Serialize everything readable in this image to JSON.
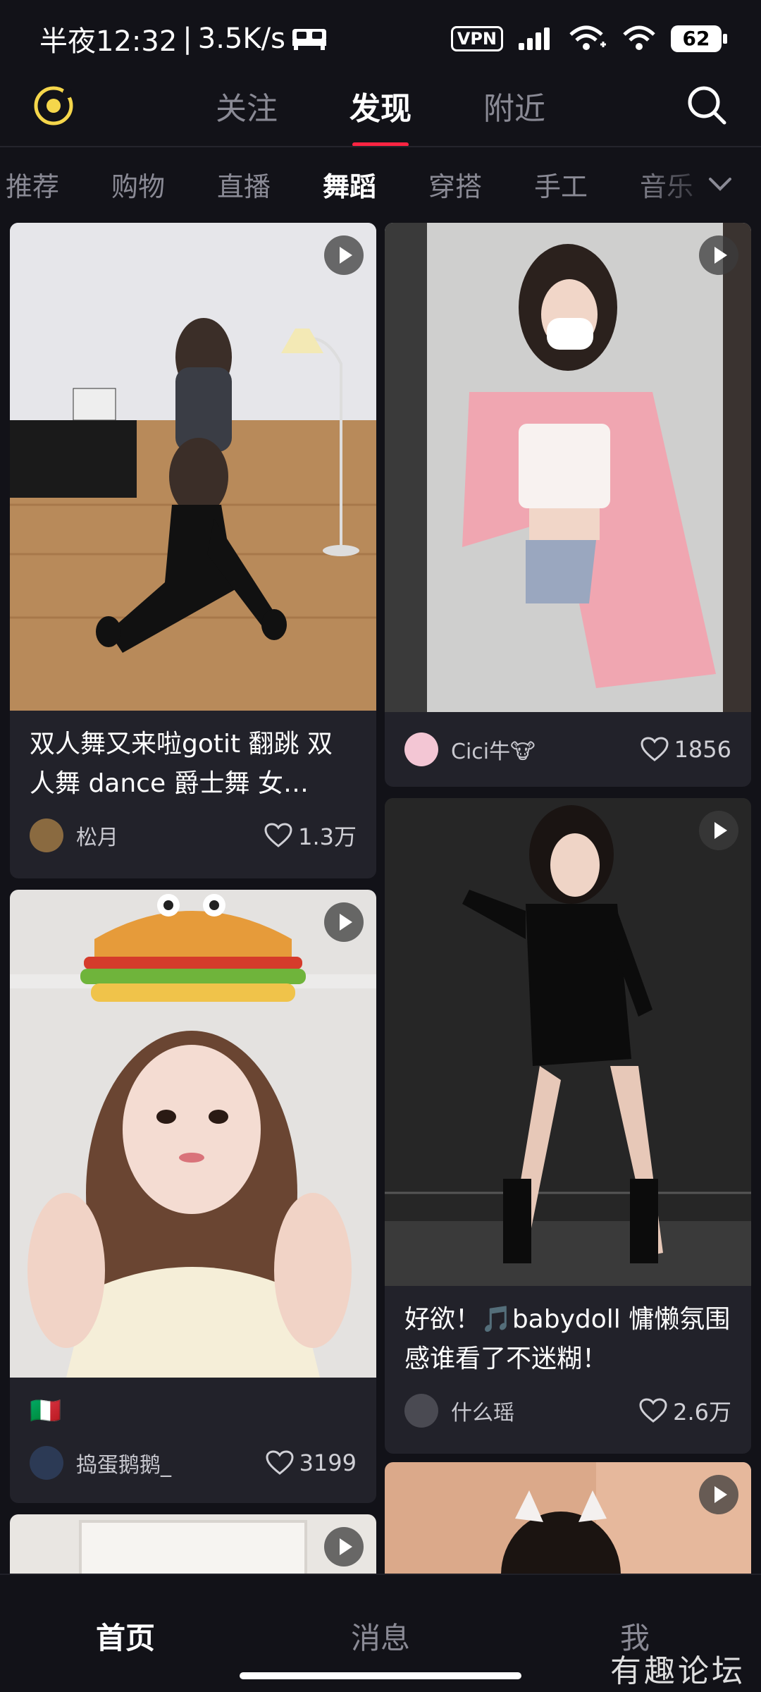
{
  "status_bar": {
    "time": "半夜12:32",
    "speed": "3.5K/s",
    "vpn": "VPN",
    "battery": "62"
  },
  "top_nav": {
    "tabs": [
      {
        "label": "关注"
      },
      {
        "label": "发现",
        "active": true
      },
      {
        "label": "附近"
      }
    ]
  },
  "categories": [
    "推荐",
    "购物",
    "直播",
    "舞蹈",
    "穿搭",
    "手工",
    "音乐"
  ],
  "active_category": "舞蹈",
  "feed": [
    {
      "title": "双人舞又来啦gotit 翻跳 双人舞 dance 爵士舞 女…",
      "author": "松月",
      "likes": "1.3万"
    },
    {
      "title": "",
      "author": "Cici牛🐮",
      "likes": "1856"
    },
    {
      "title": "🇮🇹",
      "author": "捣蛋鹅鹅_",
      "likes": "3199"
    },
    {
      "title": "好欲！🎵babydoll 慵懒氛围感谁看了不迷糊！",
      "author": "什么瑶",
      "likes": "2.6万"
    }
  ],
  "bottom_nav": {
    "items": [
      {
        "label": "首页",
        "active": true
      },
      {
        "label": "消息"
      },
      {
        "label": "我"
      }
    ]
  },
  "watermark": "有趣论坛",
  "colors": {
    "background": "#121218",
    "card": "#22222a",
    "accent": "#ff2442"
  }
}
